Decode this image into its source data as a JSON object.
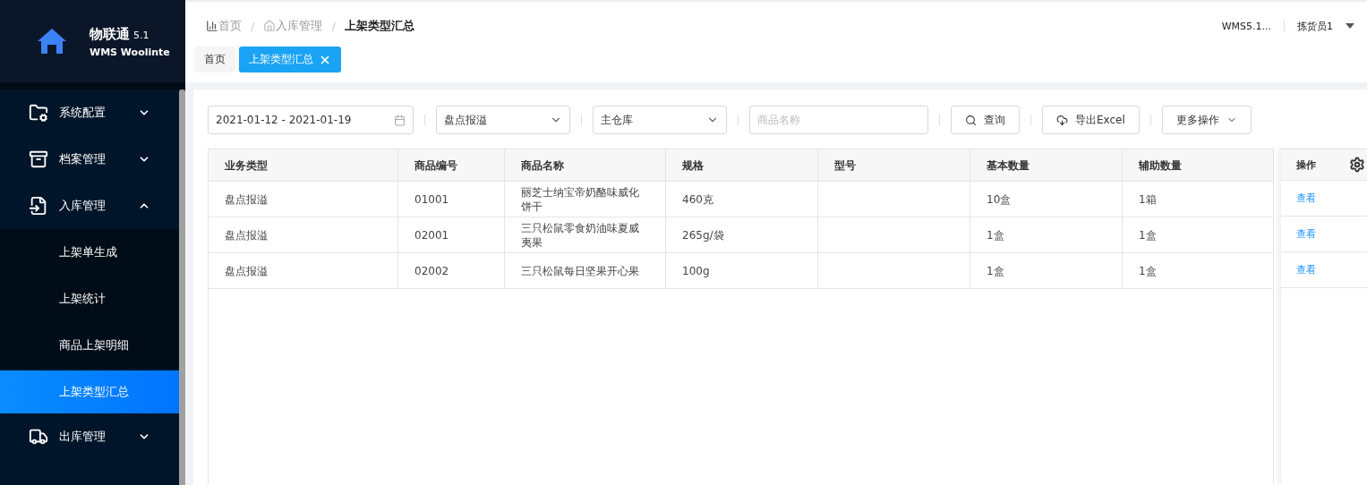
{
  "logo": {
    "name": "物联通",
    "version": "5.1",
    "subtitle": "WMS Woolinte"
  },
  "sidebar": {
    "items": [
      {
        "label": "系统配置",
        "kind": "folder",
        "expanded": false
      },
      {
        "label": "档案管理",
        "kind": "archive",
        "expanded": false
      },
      {
        "label": "入库管理",
        "kind": "inbound",
        "expanded": true,
        "children": [
          {
            "label": "上架单生成",
            "selected": false
          },
          {
            "label": "上架统计",
            "selected": false
          },
          {
            "label": "商品上架明细",
            "selected": false
          },
          {
            "label": "上架类型汇总",
            "selected": true
          }
        ]
      },
      {
        "label": "出库管理",
        "kind": "outbound",
        "expanded": false
      }
    ]
  },
  "breadcrumb": [
    {
      "label": "首页",
      "kind": "chart"
    },
    {
      "separator": "/",
      "label": "入库管理",
      "kind": "house"
    },
    {
      "separator": "/",
      "label": "上架类型汇总",
      "kind": "current"
    }
  ],
  "header": {
    "version": "WMS5.1...",
    "user": "拣货员1"
  },
  "tabs": [
    {
      "label": "首页",
      "selected": false,
      "closable": false
    },
    {
      "label": "上架类型汇总",
      "selected": true,
      "closable": true
    }
  ],
  "filters": {
    "date_range": "2021-01-12 - 2021-01-19",
    "type": "盘点报溢",
    "warehouse": "主仓库",
    "product_name": {
      "placeholder": "商品名称"
    }
  },
  "buttons": [
    {
      "label": "查询",
      "kind": "search"
    },
    {
      "label": "导出Excel",
      "kind": "export"
    },
    {
      "label": "更多操作",
      "kind": "more"
    }
  ],
  "table": {
    "columns": [
      "业务类型",
      "商品编号",
      "商品名称",
      "规格",
      "型号",
      "基本数量",
      "辅助数量"
    ],
    "action_column": "操作",
    "rows": [
      {
        "cells": [
          "盘点报溢",
          "01001",
          "丽芝士纳宝帝奶酪味威化饼干",
          "460克",
          "",
          "10盒",
          "1箱"
        ],
        "action": "查看"
      },
      {
        "cells": [
          "盘点报溢",
          "02001",
          "三只松鼠零食奶油味夏威夷果",
          "265g/袋",
          "",
          "1盒",
          "1盒"
        ],
        "action": "查看"
      },
      {
        "cells": [
          "盘点报溢",
          "02002",
          "三只松鼠每日坚果开心果",
          "100g",
          "",
          "1盒",
          "1盒"
        ],
        "action": "查看"
      }
    ]
  }
}
